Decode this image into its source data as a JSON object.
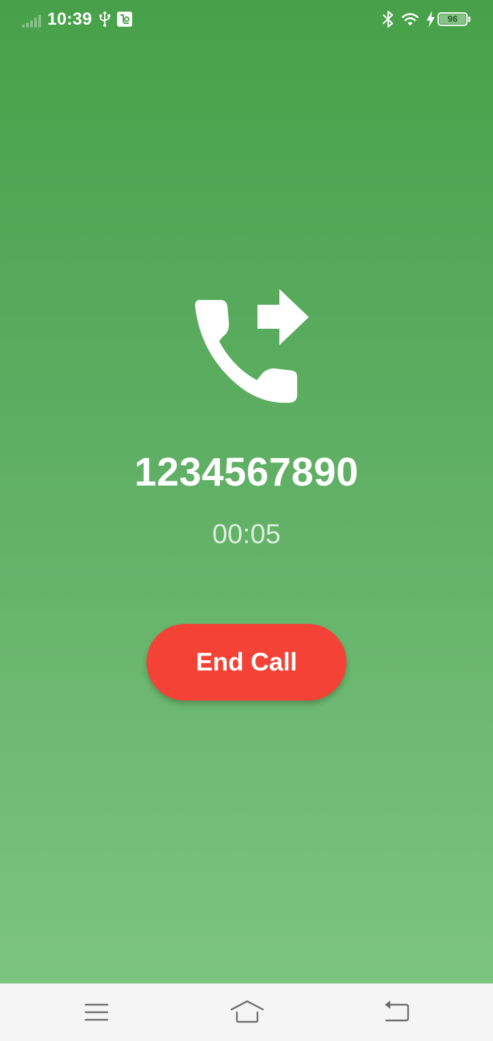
{
  "status_bar": {
    "time": "10:39",
    "battery_level": "96",
    "icons": [
      "signal-icon",
      "usb-icon",
      "app-notification-icon",
      "bluetooth-icon",
      "wifi-icon",
      "charging-icon",
      "battery-icon"
    ]
  },
  "call": {
    "icon": "outgoing-call-icon",
    "number": "1234567890",
    "duration": "00:05",
    "end_call_label": "End Call"
  },
  "nav_bar": {
    "icons": [
      "menu-icon",
      "home-icon",
      "back-icon"
    ]
  },
  "colors": {
    "background_top": "#47a149",
    "background_bottom": "#7cc47f",
    "end_call_button": "#f44336",
    "nav_bar": "#f5f5f5"
  }
}
